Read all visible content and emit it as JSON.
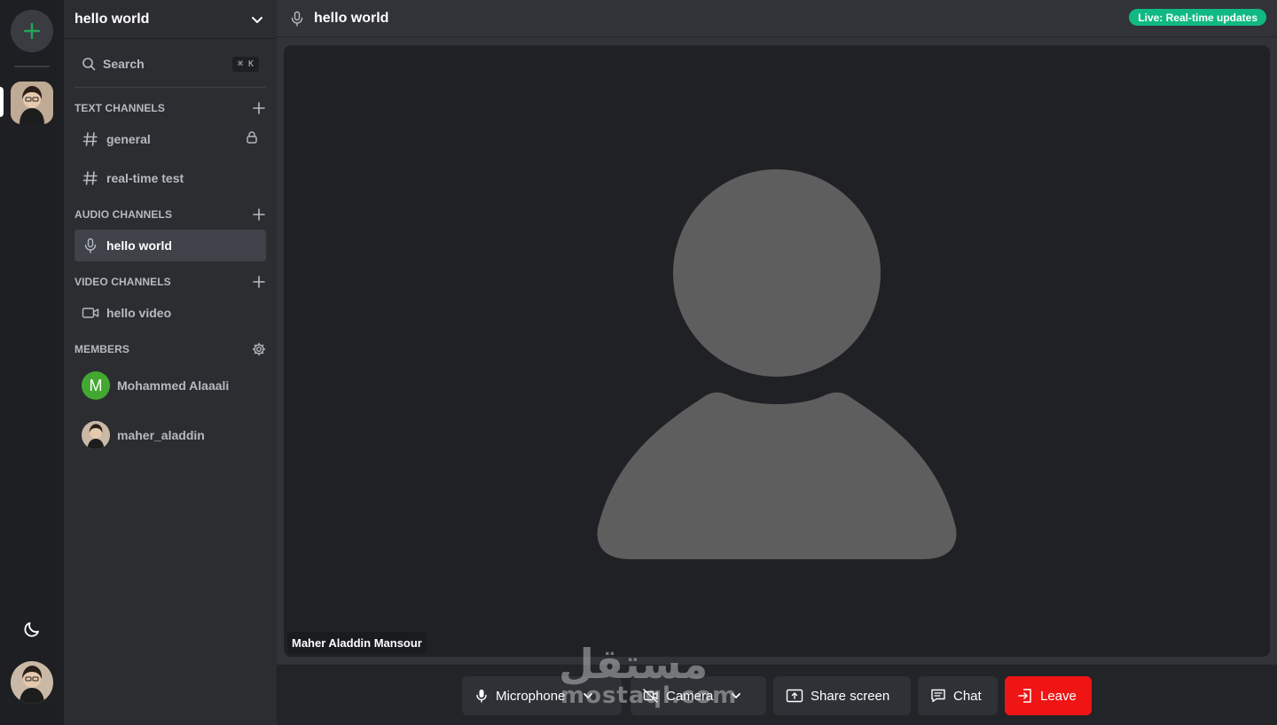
{
  "server": {
    "name": "hello world"
  },
  "search": {
    "label": "Search",
    "shortcut": "⌘ K"
  },
  "sections": {
    "text": "TEXT CHANNELS",
    "audio": "AUDIO CHANNELS",
    "video": "VIDEO CHANNELS",
    "members": "MEMBERS"
  },
  "channels": {
    "text": [
      {
        "name": "general",
        "icon": "hash-icon",
        "locked": true
      },
      {
        "name": "real-time test",
        "icon": "hash-icon",
        "locked": false
      }
    ],
    "audio": [
      {
        "name": "hello world",
        "icon": "microphone-icon",
        "active": true
      }
    ],
    "video": [
      {
        "name": "hello video",
        "icon": "video-camera-icon"
      }
    ]
  },
  "members": [
    {
      "name": "Mohammed Alaaali",
      "initial": "M",
      "avatar_color": "#43a82f"
    },
    {
      "name": "maher_aladdin",
      "initial": "",
      "avatar_color": "#8a6e5a"
    }
  ],
  "topbar": {
    "title": "hello world",
    "live_badge": "Live: Real-time updates"
  },
  "video": {
    "participant_name": "Maher Aladdin Mansour"
  },
  "controls": {
    "microphone": "Microphone",
    "camera": "Camera",
    "share_screen": "Share screen",
    "chat": "Chat",
    "leave": "Leave"
  },
  "watermark": {
    "arabic": "مستقل",
    "latin": "mostaql.com"
  },
  "colors": {
    "accent_green": "#10b981",
    "leave_red": "#f01515",
    "add_icon_green": "#23a55a"
  }
}
